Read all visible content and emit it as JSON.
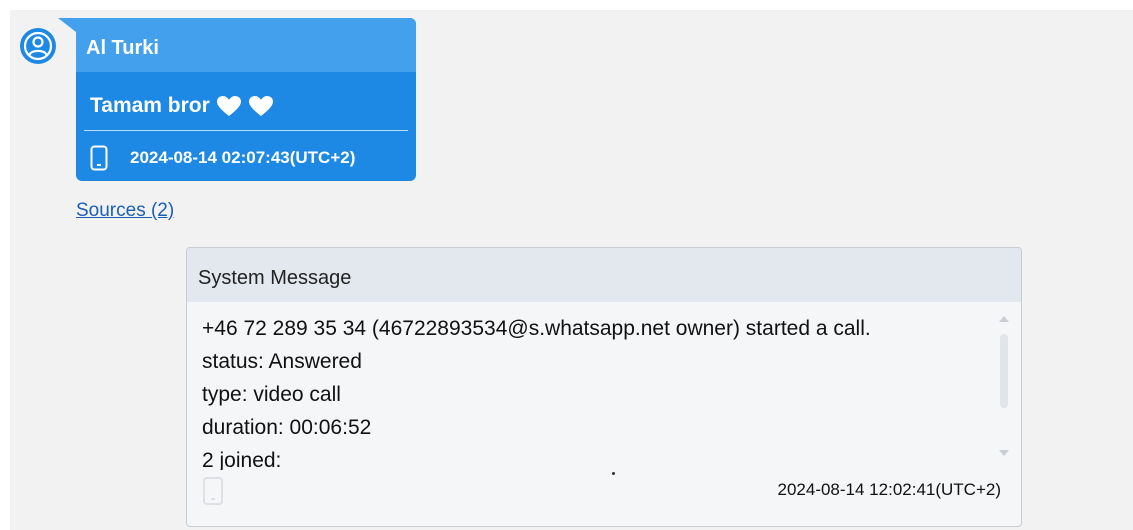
{
  "message": {
    "sender": "Al Turki",
    "text": "Tamam bror",
    "emoji": [
      "white-heart",
      "white-heart"
    ],
    "timestamp": "2024-08-14 02:07:43(UTC+2)",
    "device_icon": "phone-icon",
    "sources_label": "Sources (2)"
  },
  "system_message": {
    "title": "System Message",
    "lines": [
      "+46 72 289 35 34 (46722893534@s.whatsapp.net owner) started a call.",
      "status: Answered",
      "type: video call",
      "duration: 00:06:52",
      "2 joined:"
    ],
    "timestamp": "2024-08-14 12:02:41(UTC+2)",
    "device_icon": "phone-icon"
  },
  "colors": {
    "bubble": "#1e88e5",
    "bubble_header": "#42a0ec",
    "system_header": "#e3e8ee",
    "link": "#1a5fb4"
  }
}
